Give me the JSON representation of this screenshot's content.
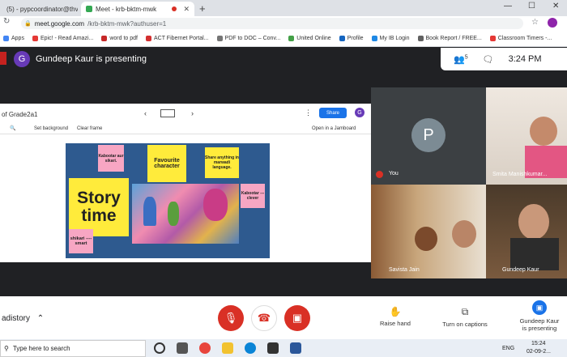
{
  "browser": {
    "tabs": [
      {
        "title": "(5) - pypcoordinator@thv..."
      },
      {
        "title": "Meet - krb-bktm-mwk"
      }
    ],
    "new_tab": "+",
    "window_controls": {
      "minimize": "—",
      "maximize": "☐",
      "close": "✕"
    },
    "url_host": "meet.google.com",
    "url_path": "/krb-bktm-mwk?authuser=1",
    "bookmarks": [
      {
        "label": "Apps",
        "color": "#4285f4"
      },
      {
        "label": "Epic! - Read Amazi...",
        "color": "#e53935"
      },
      {
        "label": "word to pdf",
        "color": "#c62828"
      },
      {
        "label": "ACT Fibernet Portal...",
        "color": "#d32f2f"
      },
      {
        "label": "PDF to DOC – Conv...",
        "color": "#757575"
      },
      {
        "label": "United Online",
        "color": "#43a047"
      },
      {
        "label": "Profile",
        "color": "#1565c0"
      },
      {
        "label": "My IB Login",
        "color": "#1e88e5"
      },
      {
        "label": "Book Report / FREE...",
        "color": "#616161"
      },
      {
        "label": "Classroom Timers -...",
        "color": "#e53935"
      }
    ]
  },
  "meet": {
    "presenter_initial": "G",
    "presenting_title": "Gundeep Kaur is presenting",
    "participant_count": "5",
    "clock": "3:24 PM",
    "colors": {
      "accent": "#1a73e8",
      "danger": "#d93025",
      "presenter": "#673ab7"
    }
  },
  "slides": {
    "doc_title": "of Grade2a1",
    "share_label": "Share",
    "account_initial": "G",
    "set_background": "Set background",
    "clear_frame": "Clear frame",
    "open_jamboard": "Open in a Jamboard",
    "slide": {
      "note_1": "Kabootar aur sikari.",
      "note_2": "Favourite character",
      "note_3": "Share anything in marwadi language.",
      "title_line_1": "Story",
      "title_line_2": "time",
      "note_4": "shikari ---- smart",
      "note_5": "Kabootar --- clever"
    }
  },
  "participants": [
    {
      "name": "You",
      "initial": "P"
    },
    {
      "name": "Smita Manishkumar..."
    },
    {
      "name": "Savista Jain"
    },
    {
      "name": "Gundeep Kaur"
    }
  ],
  "controls": {
    "left_label": "adistory",
    "raise_hand": "Raise hand",
    "captions": "Turn on captions",
    "presenting_line_1": "Gundeep Kaur",
    "presenting_line_2": "is presenting"
  },
  "taskbar": {
    "search_placeholder": "Type here to search",
    "lang": "ENG",
    "time": "15:24",
    "date": "02-09-2..."
  }
}
